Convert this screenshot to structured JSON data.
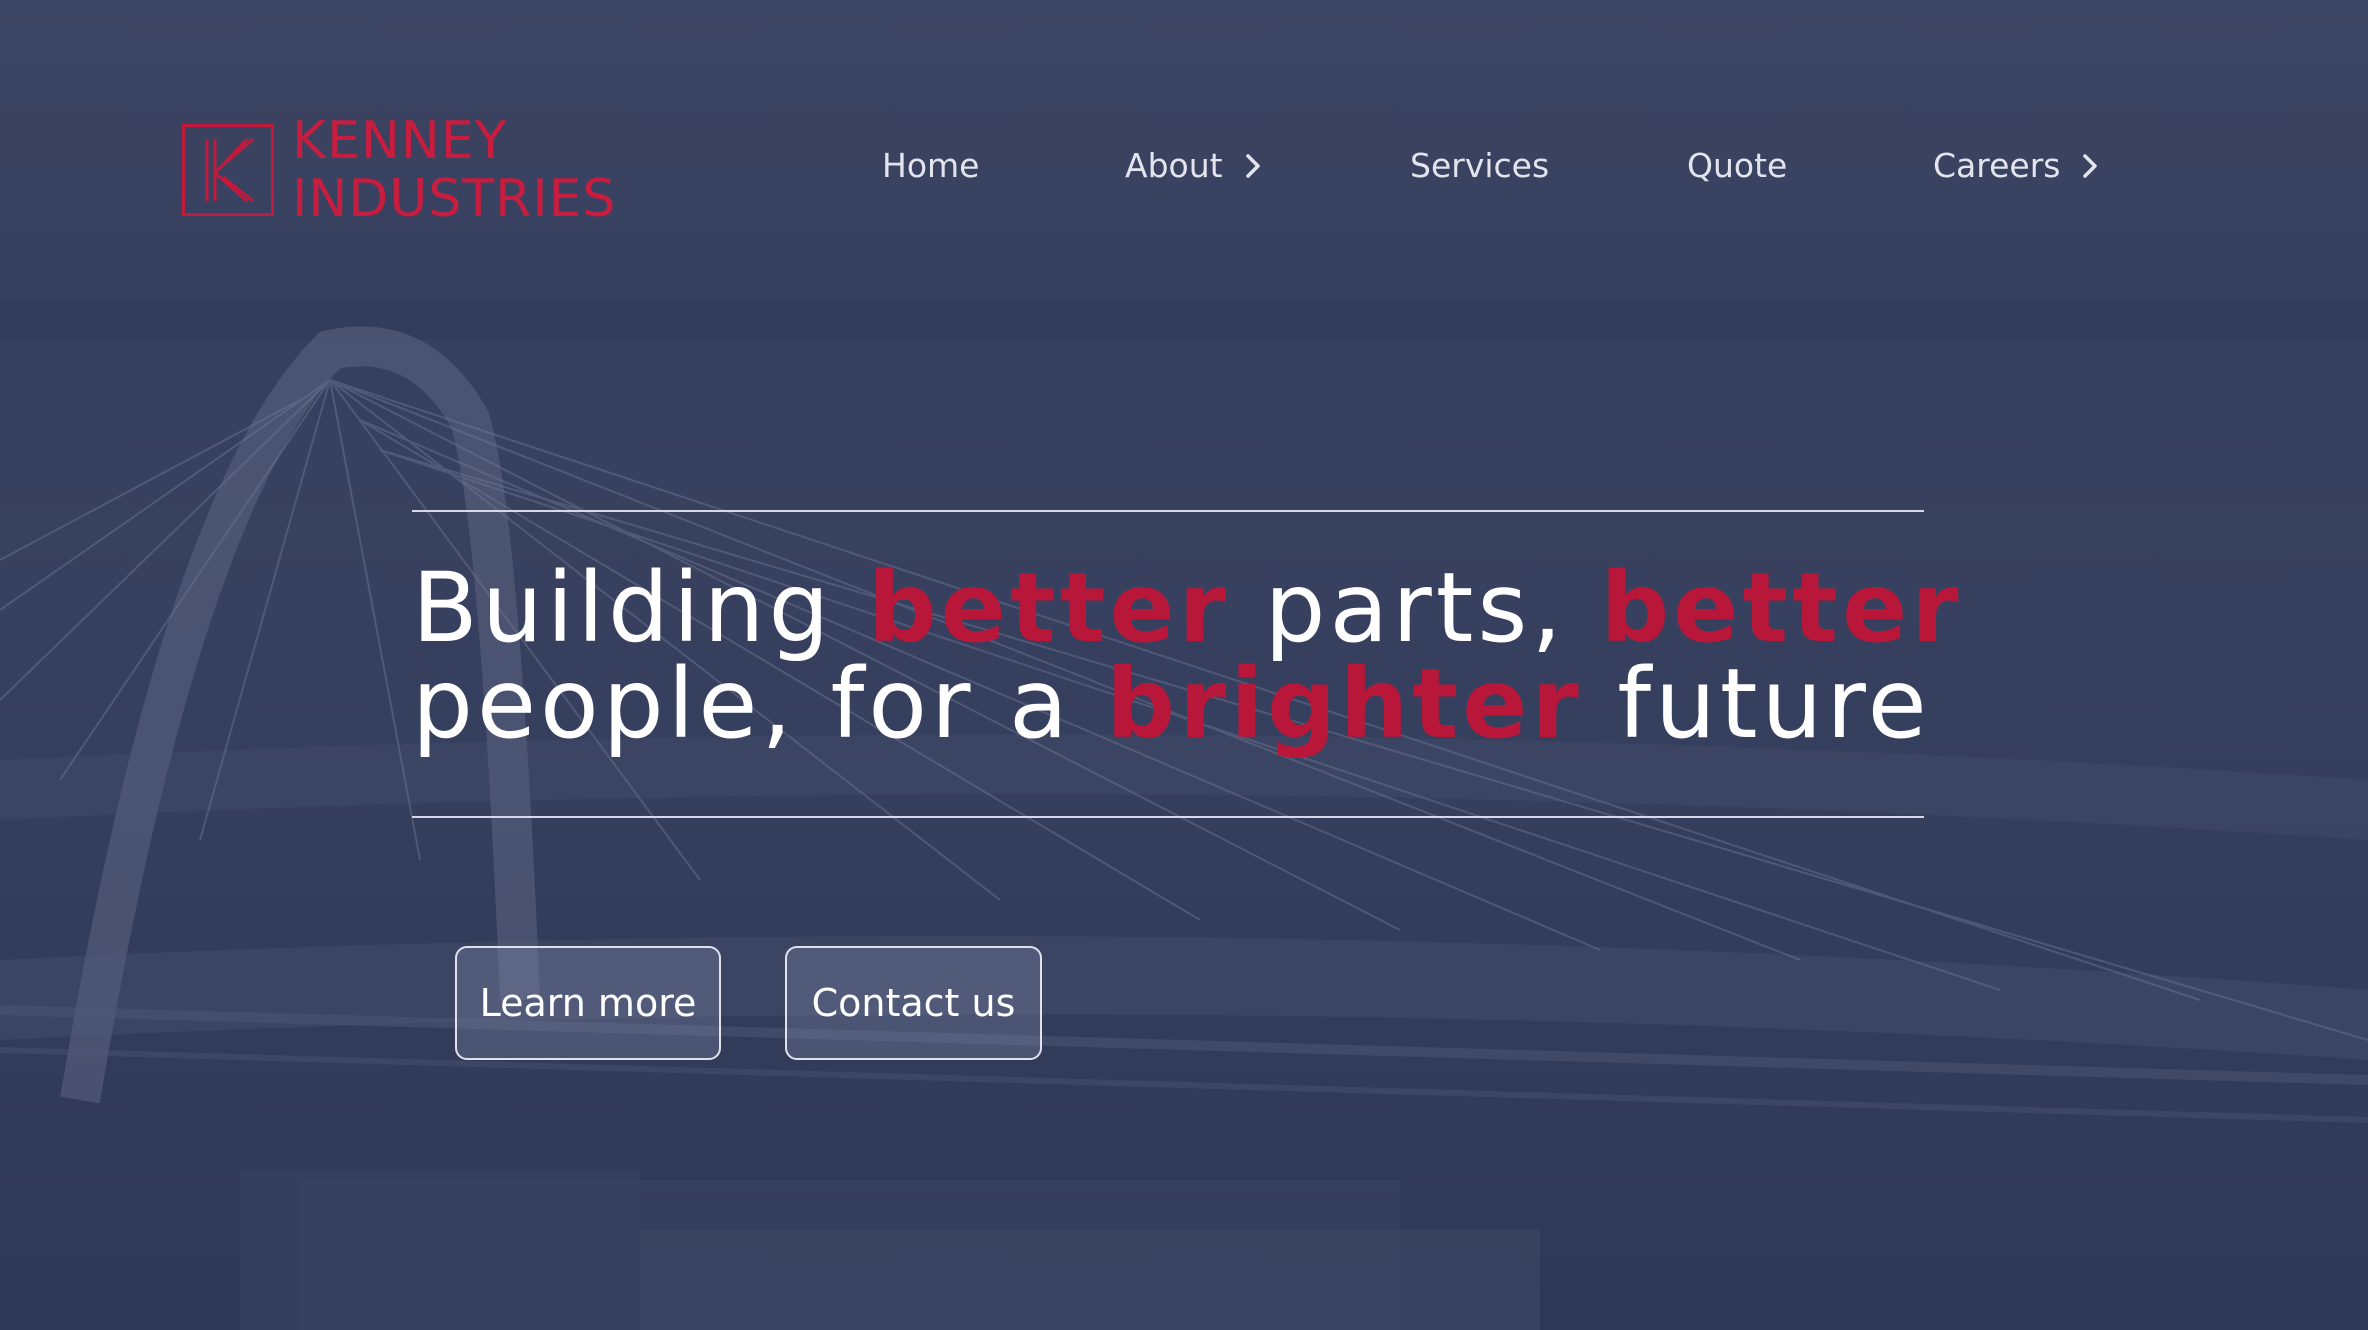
{
  "brand": {
    "mark_letter": "K",
    "name_line1": "KENNEY",
    "name_line2": "INDUSTRIES",
    "color": "#c81d3f"
  },
  "nav": {
    "items": [
      {
        "label": "Home",
        "icon": null
      },
      {
        "label": "About",
        "icon": "chevron-right-icon"
      },
      {
        "label": "Services",
        "icon": null
      },
      {
        "label": "Quote",
        "icon": null
      },
      {
        "label": "Careers",
        "icon": "chevron-right-icon"
      }
    ]
  },
  "hero": {
    "line1": [
      {
        "text": "Building ",
        "highlight": false
      },
      {
        "text": "better",
        "highlight": true
      },
      {
        "text": " parts, ",
        "highlight": false
      },
      {
        "text": "better",
        "highlight": true
      }
    ],
    "line2": [
      {
        "text": "people, for a ",
        "highlight": false
      },
      {
        "text": "brighter",
        "highlight": true
      },
      {
        "text": " future",
        "highlight": false
      }
    ],
    "highlight_color": "#b8173a",
    "background_image": "aerial-bridge-photo"
  },
  "buttons": {
    "learn_more": "Learn more",
    "contact_us": "Contact us"
  }
}
